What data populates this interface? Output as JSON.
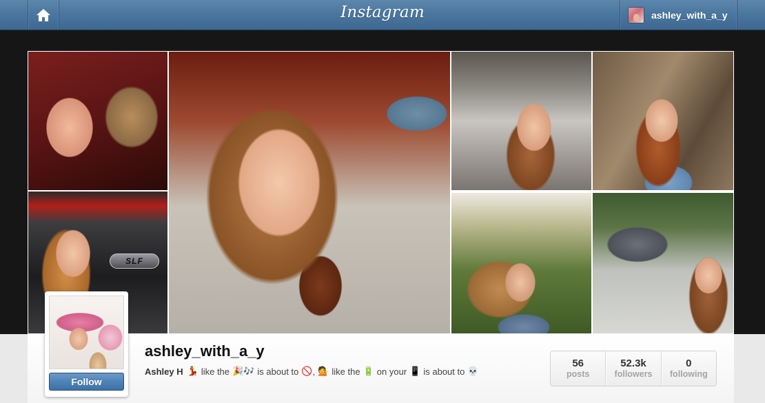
{
  "header": {
    "home_icon": "home-icon",
    "logo_text": "Instagram",
    "user": {
      "username": "ashley_with_a_y"
    }
  },
  "collage": {
    "photos": [
      {
        "subject": "selfie-with-dog"
      },
      {
        "subject": "selfie-drinking-iced-tea"
      },
      {
        "subject": "selfie-at-shop-counter"
      },
      {
        "subject": "selfie-by-tree-trunk"
      },
      {
        "subject": "selfie-by-car-badge",
        "badge_text": "SLF"
      },
      {
        "subject": "selfie-under-tree"
      },
      {
        "subject": "selfie-by-parked-car"
      }
    ]
  },
  "profile": {
    "username": "ashley_with_a_y",
    "follow_label": "Follow",
    "bio": {
      "name": "Ashley H",
      "segments": [
        {
          "emoji": "💃"
        },
        {
          "text": "like the"
        },
        {
          "emoji": "🎉🎶"
        },
        {
          "text": "is about to"
        },
        {
          "emoji": "🚫"
        },
        {
          "text": ","
        },
        {
          "emoji": "💁"
        },
        {
          "text": "like the"
        },
        {
          "emoji": "🔋"
        },
        {
          "text": "on your"
        },
        {
          "emoji": "📱"
        },
        {
          "text": "is about to"
        },
        {
          "emoji": "💀"
        }
      ]
    },
    "stats": [
      {
        "value": "56",
        "label": "posts"
      },
      {
        "value": "52.3k",
        "label": "followers"
      },
      {
        "value": "0",
        "label": "following"
      }
    ]
  },
  "colors": {
    "topbar": "#4a77a0",
    "follow_button": "#4f83b6",
    "page_background": "#161616"
  }
}
